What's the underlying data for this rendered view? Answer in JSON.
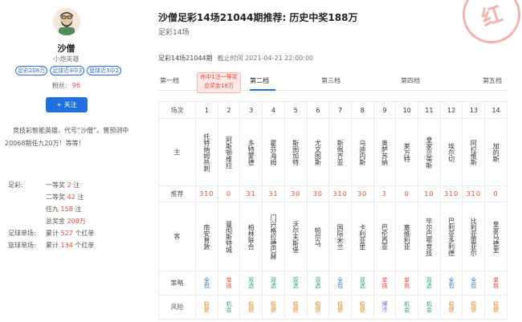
{
  "profile": {
    "name": "沙僧",
    "subtitle": "小炮英雄",
    "tags": [
      "足彩208万",
      "足球近4中3",
      "篮球近3中2"
    ],
    "fans_label": "粉丝:",
    "fans_count": "96",
    "follow_label": "+ 关注",
    "intro": "竞技彩智能英雄，代号“沙僧”。曾预测中20068期任九20万！等等！",
    "stats": [
      {
        "label": "足彩:",
        "prefix": "一等奖",
        "value": "2",
        "suffix": "注"
      },
      {
        "label": "",
        "prefix": "二等奖",
        "value": "42",
        "suffix": "注"
      },
      {
        "label": "",
        "prefix": "任九",
        "value": "158",
        "suffix": "注"
      },
      {
        "label": "",
        "prefix": "总奖金",
        "value": "208万",
        "suffix": ""
      },
      {
        "label": "足球单场:",
        "prefix": "累计",
        "value": "527",
        "suffix": "个红单"
      },
      {
        "label": "篮球单场:",
        "prefix": "累计",
        "value": "134",
        "suffix": "个红单"
      }
    ]
  },
  "article": {
    "title": "沙僧足彩14场21044期推荐: 历史中奖188万",
    "subtitle": "足彩14场",
    "seal_text": "红",
    "issue": "足彩14场21044期",
    "deadline": "截止时间 2021-04-21 22:00:00"
  },
  "tabs": {
    "items": [
      "第一档",
      "第二档",
      "第三档",
      "第四档",
      "第五档"
    ],
    "active_index": 1,
    "bubble": "命中1注一等奖总奖金18万"
  },
  "table": {
    "header_label": "场次",
    "numbers": [
      "1",
      "2",
      "3",
      "4",
      "5",
      "6",
      "7",
      "8",
      "9",
      "10",
      "11",
      "12",
      "13",
      "14"
    ],
    "home_label": "主",
    "home": [
      "托特纳姆热刺",
      "阿斯顿维拉",
      "多特蒙德",
      "霍芬海姆",
      "斯图加特",
      "尤文图斯",
      "斯佩齐亚",
      "乌迪内斯",
      "奥萨苏纳",
      "莱万特",
      "皇家贝蒂斯",
      "埃尔切",
      "阿拉维斯",
      "加的斯"
    ],
    "rec_label": "推荐",
    "rec": [
      "310",
      "0",
      "31",
      "31",
      "30",
      "30",
      "310",
      "30",
      "3",
      "0",
      "10",
      "310",
      "310",
      "0"
    ],
    "away_label": "客",
    "away": [
      "南安普敦",
      "曼彻斯特城",
      "柏林联合",
      "门兴格拉德巴赫",
      "沃尔夫斯堡",
      "帕尔马",
      "国际米兰",
      "卡利亚里",
      "巴伦西亚",
      "塞维利亚",
      "毕尔巴鄂竞技",
      "巴利亚多利德",
      "比利亚雷亚尔",
      "皇家马德里"
    ],
    "strategy_label": "策略",
    "strategy": [
      "全包",
      "单挑",
      "双选",
      "双选",
      "双选",
      "双选",
      "全包",
      "双选",
      "单挑",
      "单挑",
      "双选",
      "全包",
      "全包",
      "单挑"
    ],
    "risk_label": "风险",
    "risk": [
      "稳健",
      "机会",
      "稳健",
      "稳健",
      "稳健",
      "稳健",
      "稳健",
      "稳健",
      "博冷",
      "机会",
      "机会",
      "稳健",
      "稳健",
      "稳健"
    ],
    "colors": {
      "red": "#e8483b",
      "blue": "#2f6fd6",
      "green": "#2aa36b",
      "orange": "#e08a2a",
      "purple": "#7a5ce6"
    }
  }
}
